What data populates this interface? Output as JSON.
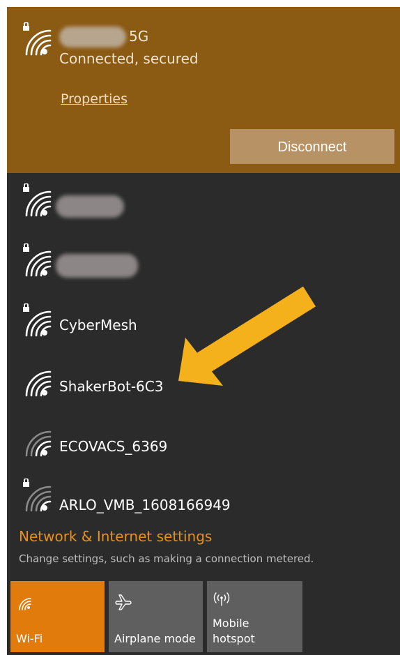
{
  "connected": {
    "ssid_suffix": "5G",
    "status": "Connected, secured",
    "properties_label": "Properties",
    "disconnect_label": "Disconnect"
  },
  "networks": [
    {
      "ssid": "",
      "secured": true,
      "blurred": true
    },
    {
      "ssid": "",
      "secured": true,
      "blurred": true
    },
    {
      "ssid": "CyberMesh",
      "secured": true
    },
    {
      "ssid": "ShakerBot-6C3",
      "secured": false
    },
    {
      "ssid": "ECOVACS_6369",
      "secured": false
    },
    {
      "ssid": "ARLO_VMB_1608166949",
      "secured": true
    }
  ],
  "settings": {
    "title": "Network & Internet settings",
    "description": "Change settings, such as making a connection metered."
  },
  "quick_actions": [
    {
      "label": "Wi-Fi",
      "active": true,
      "icon": "wifi-icon"
    },
    {
      "label": "Airplane mode",
      "active": false,
      "icon": "airplane-icon"
    },
    {
      "label_line1": "Mobile",
      "label_line2": "hotspot",
      "active": false,
      "icon": "hotspot-icon"
    }
  ],
  "colors": {
    "accent": "#8b5a13",
    "tile_active": "#e07b0c",
    "panel_bg": "#2b2b2b",
    "settings_link": "#e8901b",
    "arrow": "#f4b11c"
  }
}
